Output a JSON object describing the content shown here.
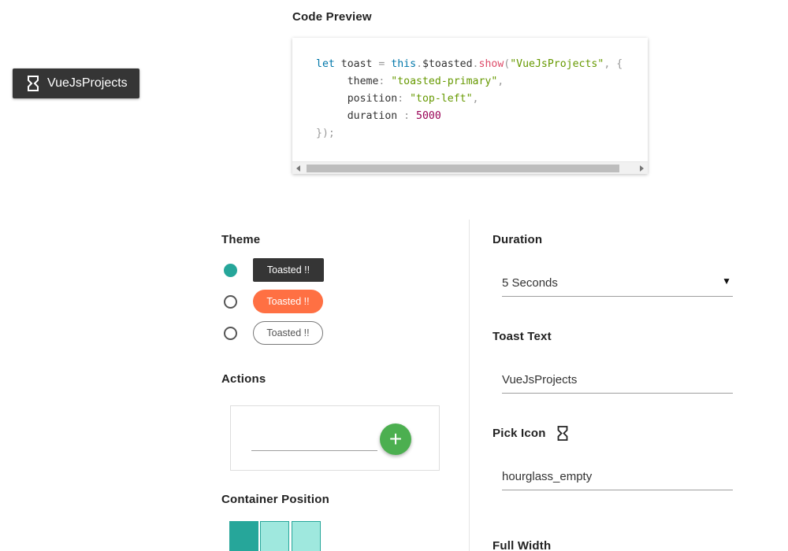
{
  "toast": {
    "text": "VueJsProjects",
    "icon": "hourglass-icon"
  },
  "code_preview": {
    "title": "Code Preview",
    "lines": {
      "l1_kw": "let",
      "l1_var": " toast ",
      "l1_eq": "=",
      "l1_this": " this",
      "l1_dot1": ".",
      "l1_obj": "$toasted",
      "l1_dot2": ".",
      "l1_fn": "show",
      "l1_open": "(",
      "l1_str": "\"VueJsProjects\"",
      "l1_rest": ", {",
      "l2_prop": "     theme",
      "l2_colon": ":",
      "l2_str": " \"toasted-primary\"",
      "l2_comma": ",",
      "l3_prop": "     position",
      "l3_colon": ":",
      "l3_str": " \"top-left\"",
      "l3_comma": ",",
      "l4_prop": "     duration ",
      "l4_colon": ":",
      "l4_num": " 5000",
      "l5": "});"
    }
  },
  "theme": {
    "heading": "Theme",
    "options": [
      {
        "label": "Toasted !!",
        "selected": true,
        "style": "dark"
      },
      {
        "label": "Toasted !!",
        "selected": false,
        "style": "orange"
      },
      {
        "label": "Toasted !!",
        "selected": false,
        "style": "outline"
      }
    ]
  },
  "actions": {
    "heading": "Actions",
    "input_value": "",
    "add_icon": "plus-icon",
    "add_label": "+"
  },
  "container_position": {
    "heading": "Container Position"
  },
  "duration": {
    "heading": "Duration",
    "selected": "5 Seconds",
    "arrow": "▼"
  },
  "toast_text": {
    "heading": "Toast Text",
    "value": "VueJsProjects"
  },
  "pick_icon": {
    "heading": "Pick Icon",
    "value": "hourglass_empty",
    "icon": "hourglass-icon"
  },
  "full_width": {
    "heading": "Full Width"
  },
  "colors": {
    "accent": "#26a69a",
    "dark": "#353535",
    "orange": "#ff7043",
    "green": "#4caf50",
    "swatch_light": "#9fe8de"
  }
}
